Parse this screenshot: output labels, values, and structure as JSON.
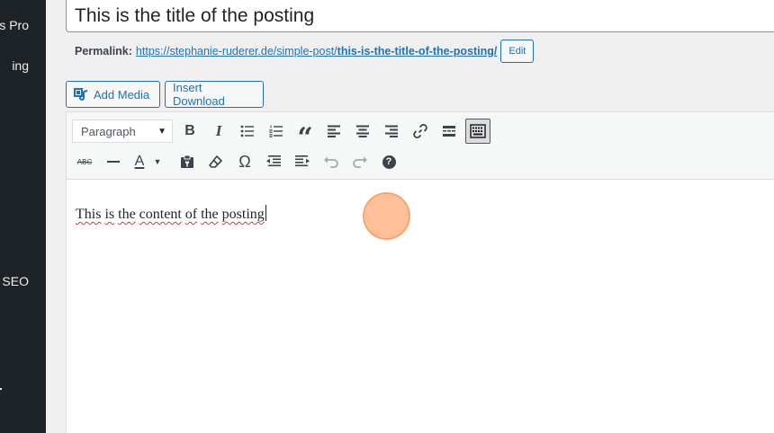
{
  "sidebar": {
    "items": [
      {
        "label": "s Pro"
      },
      {
        "label": "ing"
      },
      {
        "label": "SEO"
      }
    ]
  },
  "post": {
    "title": "This is the title of the posting"
  },
  "permalink": {
    "label": "Permalink:",
    "url_base": "https://stephanie-ruderer.de/simple-post/",
    "url_slug": "this-is-the-title-of-the-posting/",
    "edit_label": "Edit"
  },
  "media_buttons": {
    "add_media": "Add Media",
    "insert_download": "Insert Download"
  },
  "toolbar": {
    "format_value": "Paragraph",
    "row1_icons": [
      "bold-icon",
      "italic-icon",
      "bulleted-list-icon",
      "numbered-list-icon",
      "blockquote-icon",
      "align-left-icon",
      "align-center-icon",
      "align-right-icon",
      "insert-link-icon",
      "read-more-icon",
      "toolbar-toggle-icon"
    ],
    "row2_icons": [
      "strikethrough-icon",
      "horizontal-line-icon",
      "text-color-icon",
      "paste-as-text-icon",
      "clear-formatting-icon",
      "special-character-icon",
      "decrease-indent-icon",
      "increase-indent-icon",
      "undo-icon",
      "redo-icon",
      "keyboard-shortcuts-icon"
    ],
    "bold_glyph": "B",
    "italic_glyph": "I",
    "quote_glyph": "“",
    "strike_glyph": "ABC",
    "textcolor_glyph": "A",
    "omega_glyph": "Ω",
    "help_glyph": "?"
  },
  "editor": {
    "content_words": [
      "This",
      "is",
      "the",
      "content",
      "of",
      "the",
      "posting"
    ]
  },
  "colors": {
    "sidebar_bg": "#1d2327",
    "link": "#2271b1",
    "click_marker": "#ffb587"
  }
}
